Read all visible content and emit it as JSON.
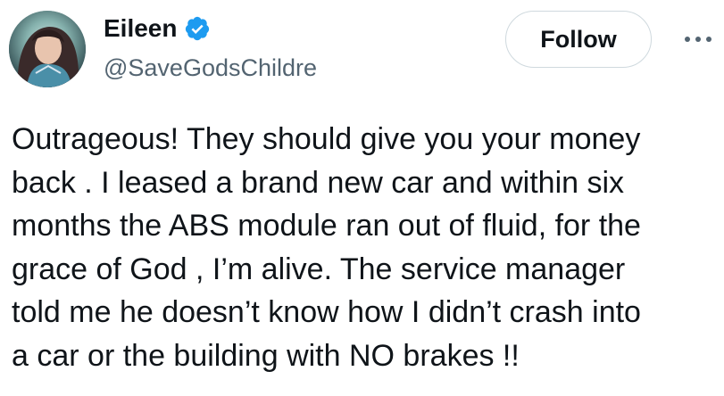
{
  "author": {
    "display_name": "Eileen",
    "handle": "@SaveGodsChildre",
    "verified": true,
    "verified_color": "#1d9bf0"
  },
  "actions": {
    "follow_label": "Follow",
    "more_icon": "more-horizontal-icon"
  },
  "tweet": {
    "text": "Outrageous! They should give you your money\nback . I leased a brand new car and within six\nmonths the ABS module ran out of fluid, for the\ngrace of God , I’m alive. The service manager\ntold me he doesn’t know how I didn’t crash into\na car or the building with NO brakes !!"
  },
  "colors": {
    "text_primary": "#0f1419",
    "text_secondary": "#536471",
    "button_border": "#cfd9de"
  }
}
